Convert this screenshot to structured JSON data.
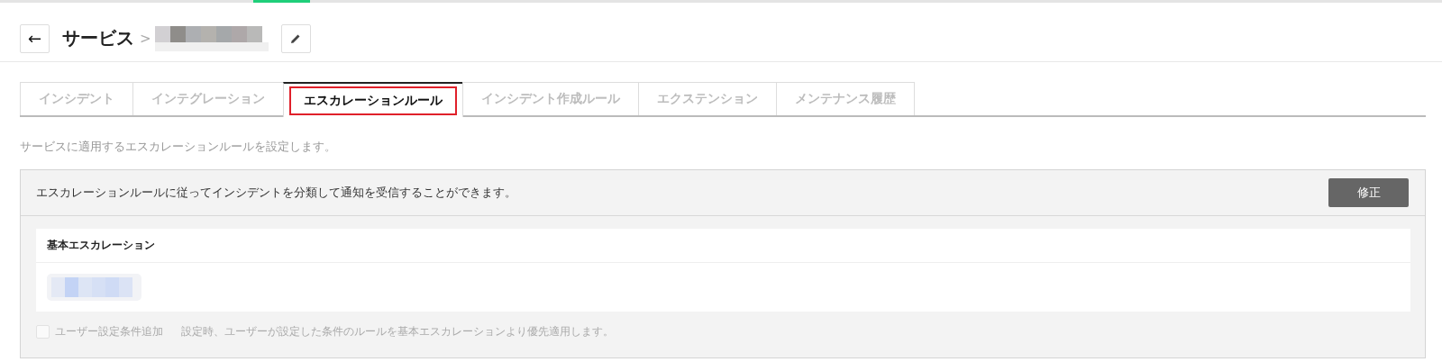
{
  "header": {
    "back_icon": "←",
    "title": "サービス",
    "separator": ">"
  },
  "tabs": [
    {
      "label": "インシデント",
      "selected": false
    },
    {
      "label": "インテグレーション",
      "selected": false
    },
    {
      "label": "エスカレーションルール",
      "selected": true
    },
    {
      "label": "インシデント作成ルール",
      "selected": false
    },
    {
      "label": "エクステンション",
      "selected": false
    },
    {
      "label": "メンテナンス履歴",
      "selected": false
    }
  ],
  "description": "サービスに適用するエスカレーションルールを設定します。",
  "panel": {
    "message": "エスカレーションルールに従ってインシデントを分類して通知を受信することができます。",
    "edit_button": "修正",
    "card": {
      "title": "基本エスカレーション"
    },
    "option": {
      "label": "ユーザー設定条件追加",
      "hint": "設定時、ユーザーが設定した条件のルールを基本エスカレーションより優先適用します。",
      "checked": false,
      "disabled": true
    }
  }
}
